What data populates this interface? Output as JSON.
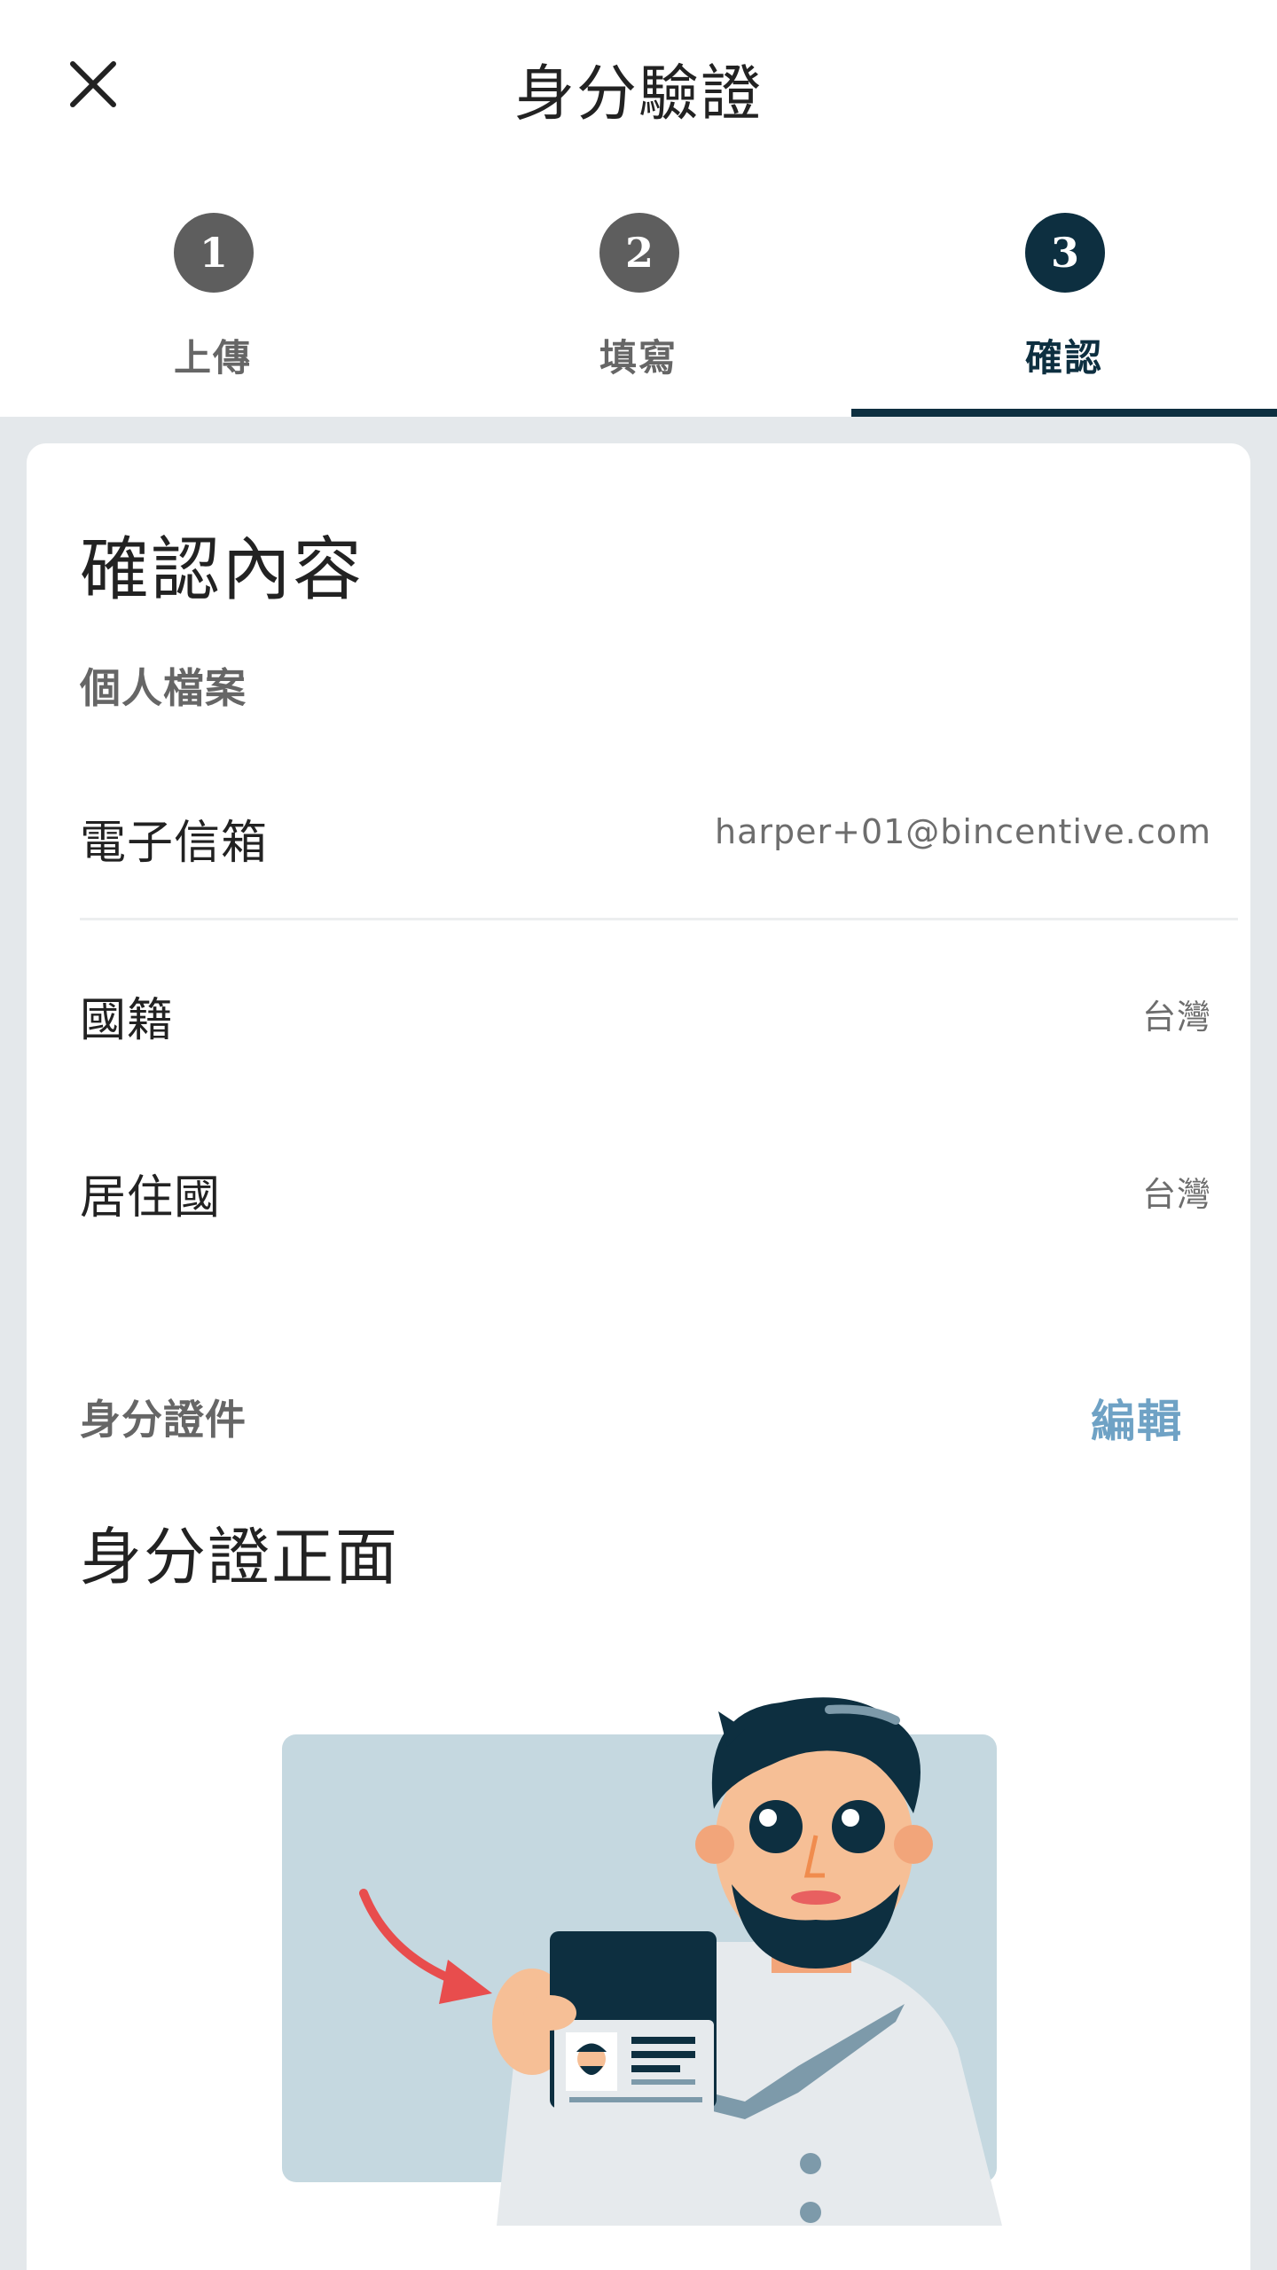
{
  "header": {
    "title": "身分驗證",
    "close_icon": "close-icon"
  },
  "steps": [
    {
      "number": "1",
      "label": "上傳",
      "active": false
    },
    {
      "number": "2",
      "label": "填寫",
      "active": false
    },
    {
      "number": "3",
      "label": "確認",
      "active": true
    }
  ],
  "confirm": {
    "title": "確認內容",
    "profile": {
      "heading": "個人檔案",
      "rows": [
        {
          "label": "電子信箱",
          "value": "harper+01@bincentive.com"
        },
        {
          "label": "國籍",
          "value": "台灣"
        },
        {
          "label": "居住國",
          "value": "台灣"
        }
      ]
    },
    "id_document": {
      "heading": "身分證件",
      "edit_label": "編輯",
      "front_title": "身分證正面",
      "illustration_icon": "id-card-holding-illustration"
    }
  },
  "colors": {
    "primary": "#0d2f40",
    "inactive_step": "#5e5e5e",
    "link": "#6fa2c5",
    "background": "#e4e8eb"
  }
}
